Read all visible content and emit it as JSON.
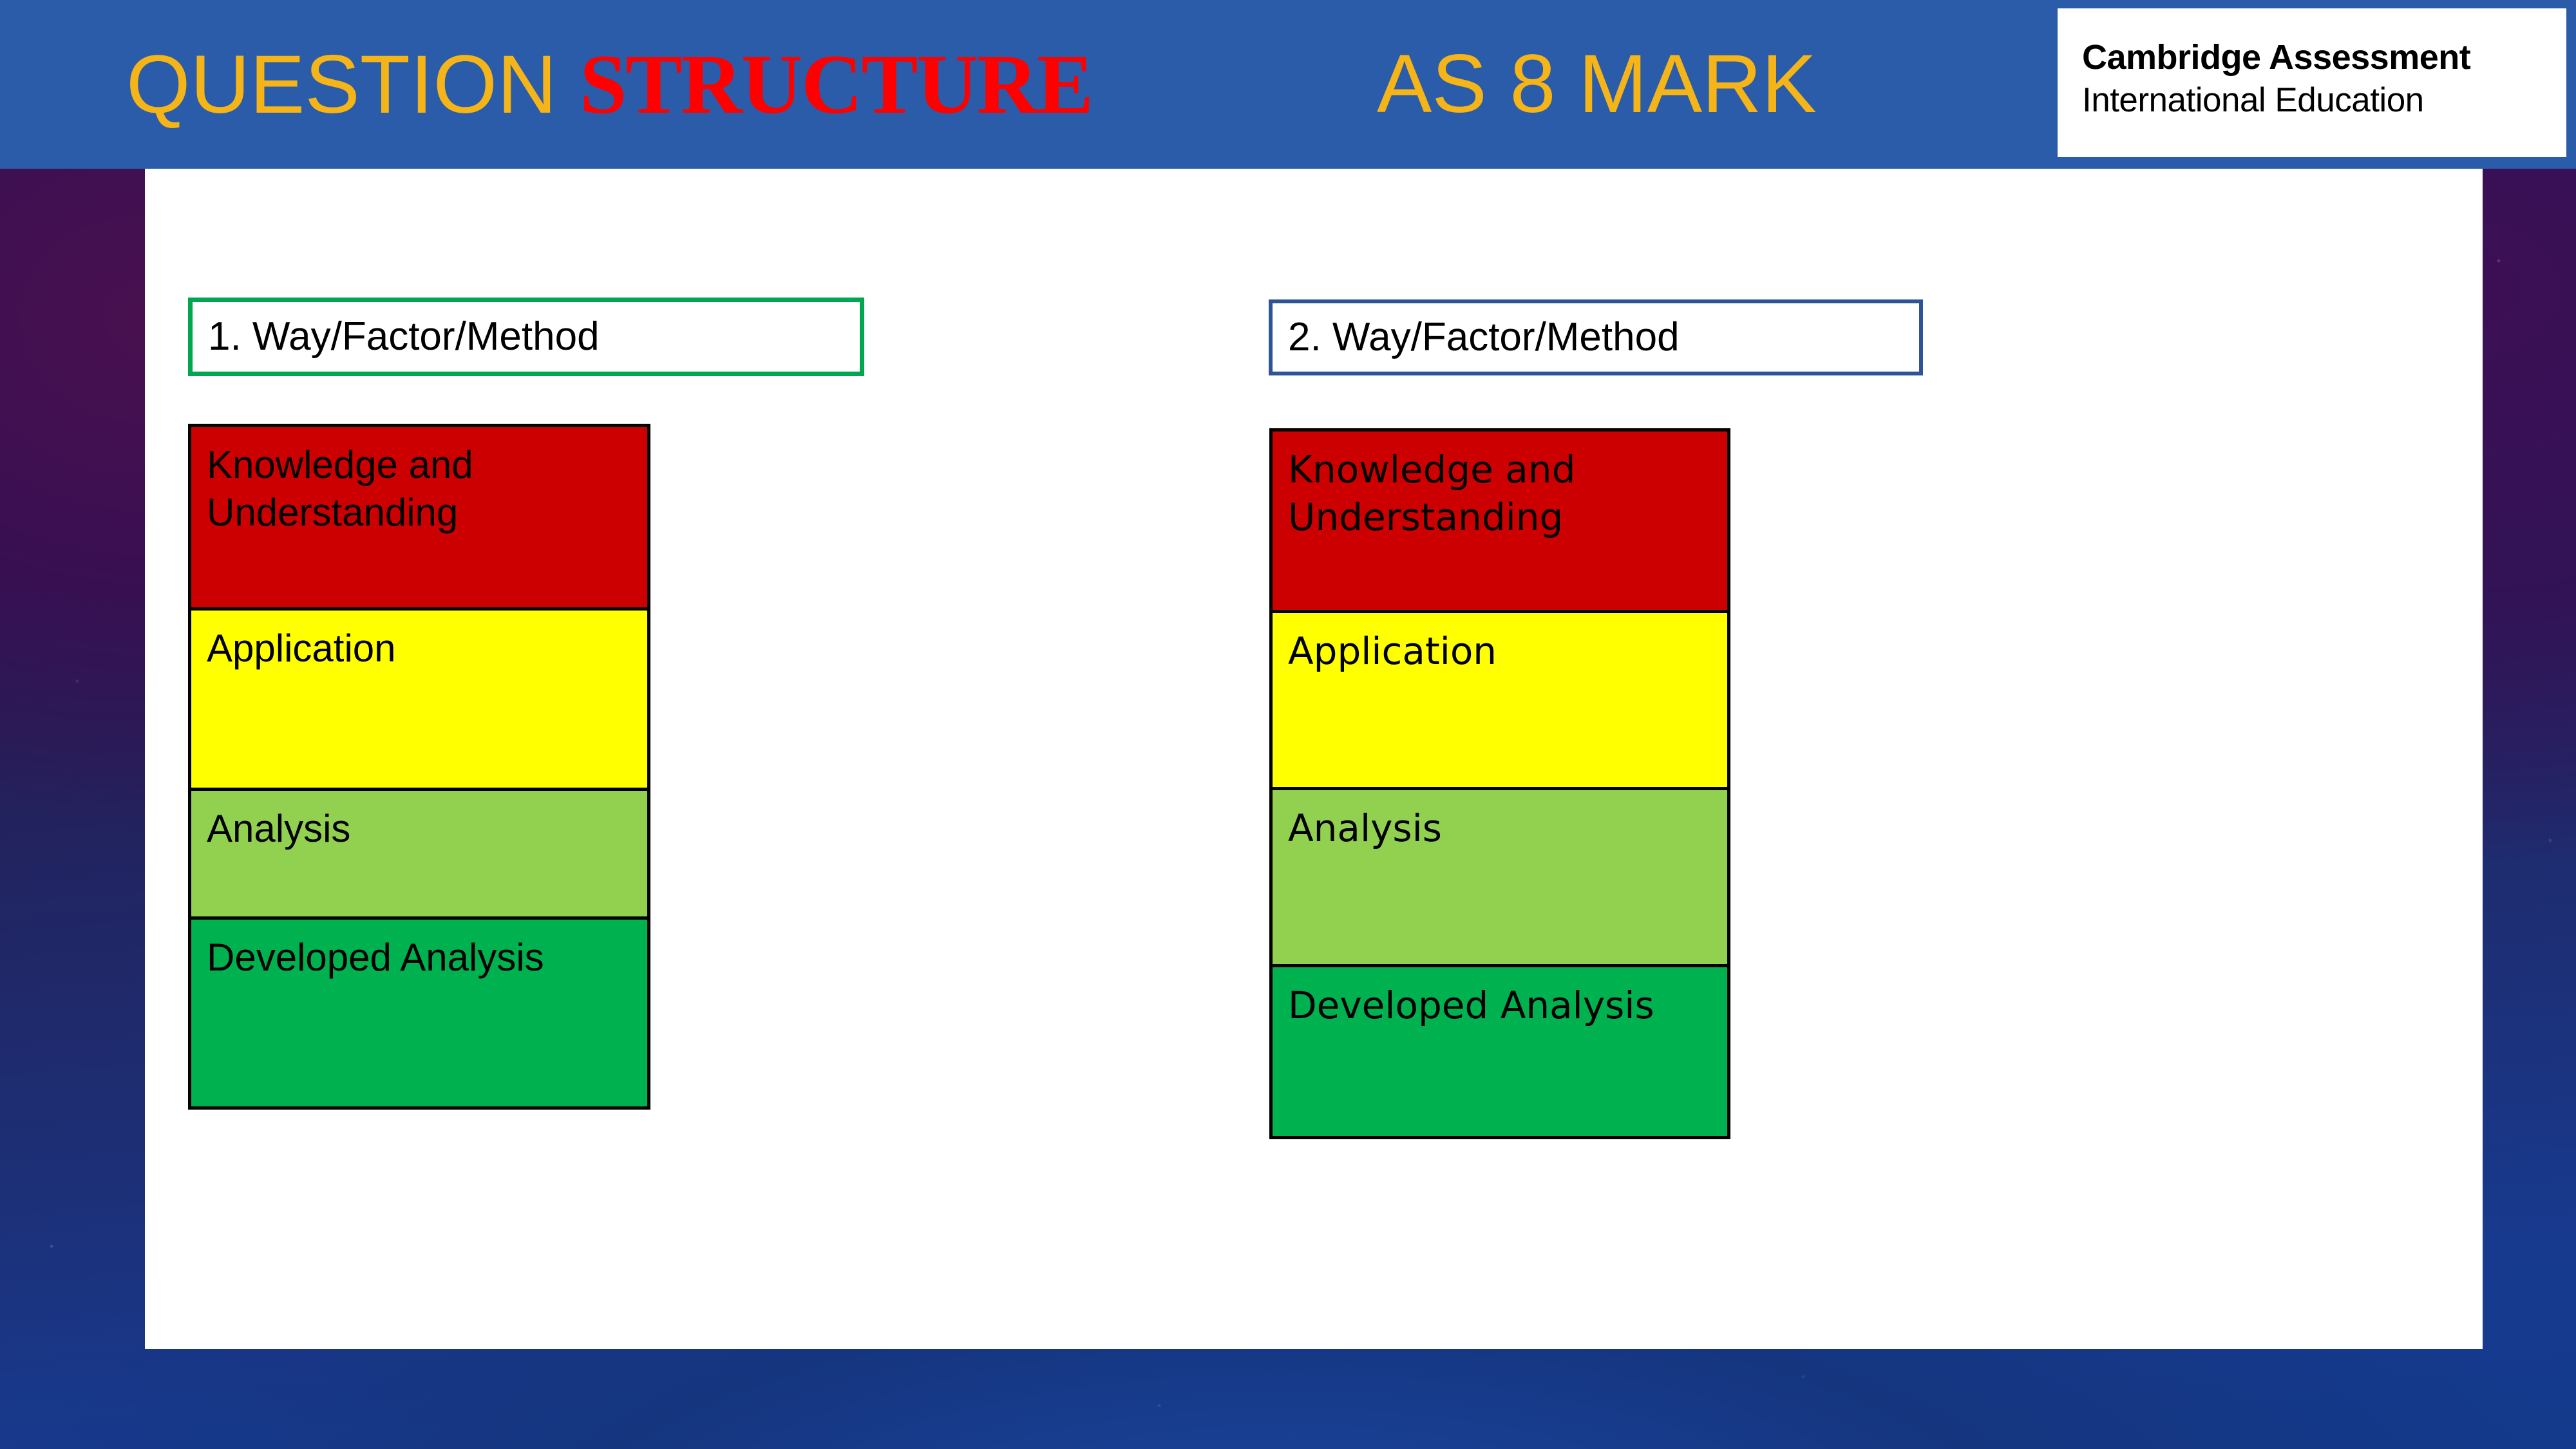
{
  "slide": {
    "title": {
      "word_1": "QUESTION ",
      "word_2": "STRUCTURE",
      "word_1_color": "#F5B417",
      "word_2_color": "#FF0000"
    },
    "subtitle": "AS 8 MARK",
    "title_bar_color": "#2A5CAA",
    "background_colors": [
      "#2C0F4E",
      "#232059",
      "#173A8F"
    ]
  },
  "logo": {
    "line_1": "Cambridge Assessment",
    "line_2": "International Education"
  },
  "columns": [
    {
      "header_label": "1. Way/Factor/Method",
      "header_border_color": "#00A650",
      "levels": [
        {
          "label": "Knowledge and\nUnderstanding",
          "color": "#CC0000"
        },
        {
          "label": "Application",
          "color": "#FFFF00"
        },
        {
          "label": "Analysis",
          "color": "#92D14F"
        },
        {
          "label": "Developed Analysis",
          "color": "#00B14F"
        }
      ]
    },
    {
      "header_label": "2. Way/Factor/Method",
      "header_border_color": "#2E5496",
      "levels": [
        {
          "label": "Knowledge and\nUnderstanding",
          "color": "#CC0000"
        },
        {
          "label": "Application",
          "color": "#FFFF00"
        },
        {
          "label": "Analysis",
          "color": "#92D14F"
        },
        {
          "label": "Developed Analysis",
          "color": "#00B14F"
        }
      ]
    }
  ]
}
